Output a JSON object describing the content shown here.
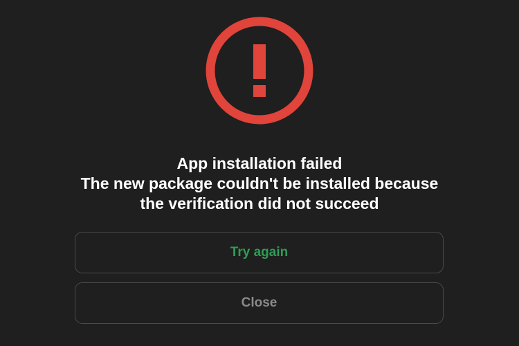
{
  "dialog": {
    "title": "App installation failed",
    "message_line1": "The new package couldn't be installed because",
    "message_line2": "the verification did not succeed",
    "icon": "error-exclamation-icon"
  },
  "buttons": {
    "retry_label": "Try again",
    "close_label": "Close"
  },
  "colors": {
    "background": "#1f1f1f",
    "error": "#e0443a",
    "retry_text": "#2e9d55",
    "close_text": "#8a8a8a",
    "button_border": "#4a4a4a",
    "text": "#ffffff"
  }
}
